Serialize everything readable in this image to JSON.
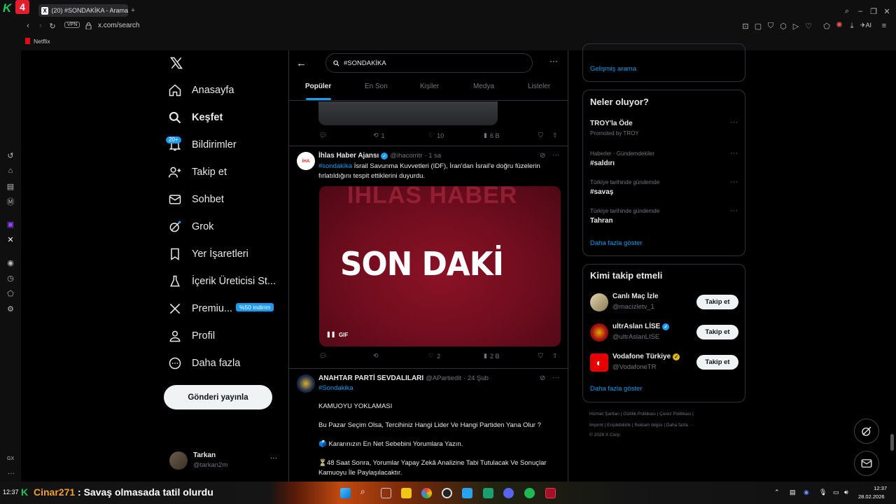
{
  "browser": {
    "tab_title": "(20) #SONDAKİKA - Arama",
    "url": "x.com/search",
    "vpn_label": "VPN",
    "bookmark": "Netflix"
  },
  "nav": {
    "home": "Anasayfa",
    "explore": "Keşfet",
    "notifications": "Bildirimler",
    "notifications_badge": "20+",
    "follow": "Takip et",
    "chat": "Sohbet",
    "grok": "Grok",
    "bookmarks": "Yer İşaretleri",
    "creator": "İçerik Üreticisi St...",
    "premium": "Premiu...",
    "premium_badge": "%50 indirim",
    "profile": "Profil",
    "more": "Daha fazla",
    "post_button": "Gönderi yayınla"
  },
  "account": {
    "name": "Tarkan",
    "handle": "@tarkan2m"
  },
  "search": {
    "query": "#SONDAKİKA"
  },
  "tabs": [
    "Popüler",
    "En Son",
    "Kişiler",
    "Medya",
    "Listeler"
  ],
  "tweet0": {
    "replies": "",
    "retweets": "1",
    "likes": "10",
    "views": "6 B"
  },
  "tweet1": {
    "name": "İhlas Haber Ajansı",
    "handle": "@ihacomtr",
    "time": "· 1 sa",
    "hashtag": "#sondakika",
    "text": " İsrail Savunma Kuvvetleri (IDF), İran'dan İsrail'e doğru füzelerin fırlatıldığını tespit ettiklerini duyurdu.",
    "media_text": "SON DAKİ",
    "media_bg_text": "İHLAS HABER",
    "gif_label": "GIF",
    "likes": "2",
    "views": "2 B",
    "avatar_text": "İHA"
  },
  "tweet2": {
    "name": "ANAHTAR PARTİ SEVDALILARI",
    "handle": "@APartiedit",
    "time": "· 24 Şub",
    "hashtag": "#Sondakika",
    "line1": "KAMUOYU YOKLAMASI",
    "line2": "Bu Pazar Seçim Olsa, Tercihiniz Hangi Lider Ve Hangi Partiden Yana Olur ?",
    "line3": "🗳️ Kararınızın En Net Sebebini Yorumlara Yazın.",
    "line4": "⏳48 Saat Sonra, Yorumlar Yapay Zekâ Analizine Tabi Tutulacak Ve Sonuçlar Kamuoyu İle Paylaşılacaktır."
  },
  "right": {
    "advanced_search": "Gelişmiş arama",
    "trends_title": "Neler oluyor?",
    "trends": [
      {
        "sub": "",
        "title": "TROY'la Öde",
        "promo": "Promoted by TROY"
      },
      {
        "sub": "Haberler · Gündemdekiler",
        "title": "#saldırı"
      },
      {
        "sub": "Türkiye tarihinde gündemde",
        "title": "#savaş"
      },
      {
        "sub": "Türkiye tarihinde gündemde",
        "title": "Tahran"
      }
    ],
    "show_more": "Daha fazla göster",
    "who_title": "Kimi takip etmeli",
    "who": [
      {
        "name": "Canlı Maç İzle",
        "handle": "@macizletv_1",
        "button": "Takip et"
      },
      {
        "name": "ultrAslan LİSE",
        "handle": "@ultrAslanLISE",
        "button": "Takip et"
      },
      {
        "name": "Vodafone Türkiye",
        "handle": "@VodafoneTR",
        "button": "Takip et"
      }
    ],
    "footer1": "Hizmet Şartları  |  Gizlilik Politikası  |  Çerez Politikası  |",
    "footer2": "Imprint  |  Erişilebilirlik  |  Reklam bilgisi  |  Daha fazla ···",
    "footer3": "© 2026 X Corp."
  },
  "taskbar": {
    "time_left": "12:37",
    "stream_user": "Cinar271",
    "stream_msg": " : Savaş olmasada tatil olurdu",
    "clock_time": "12:37",
    "clock_date": "28.02.2026",
    "gx": "GX"
  },
  "colors": {
    "accent": "#1d9bf0",
    "bg": "#000000",
    "border": "#2f3336",
    "muted": "#71767b"
  }
}
